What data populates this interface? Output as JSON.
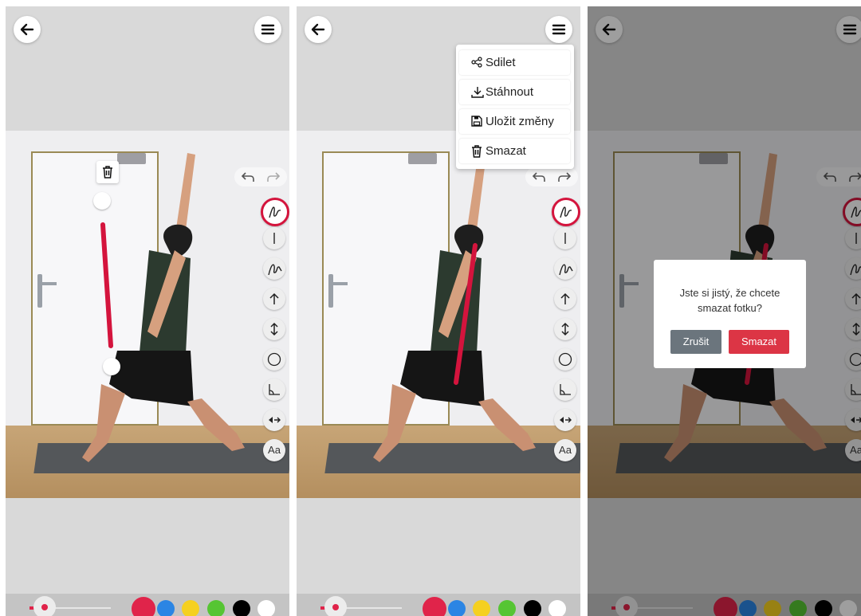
{
  "colors": {
    "accent": "#e0244a",
    "palette": [
      "#e0244a",
      "#2b85e4",
      "#f5d020",
      "#56c533",
      "#000000",
      "#ffffff"
    ]
  },
  "icons": {
    "back": "arrow-left-icon",
    "menu": "hamburger-menu-icon",
    "undo": "undo-icon",
    "redo": "redo-icon",
    "tools": [
      "freehand-curve-icon",
      "straight-line-icon",
      "double-curve-icon",
      "arrow-up-icon",
      "double-arrow-icon",
      "circle-icon",
      "angle-icon",
      "eye-arrow-icon",
      "text-icon"
    ]
  },
  "tools": {
    "text_label": "Aa"
  },
  "menu": {
    "items": [
      {
        "label": "Sdilet",
        "icon": "share-icon"
      },
      {
        "label": "Stáhnout",
        "icon": "download-icon"
      },
      {
        "label": "Uložit změny",
        "icon": "save-icon"
      },
      {
        "label": "Smazat",
        "icon": "trash-icon"
      }
    ]
  },
  "dialog": {
    "message": "Jste si jistý, že chcete smazat fotku?",
    "cancel_label": "Zrušit",
    "delete_label": "Smazat"
  },
  "stroke_width": {
    "value": 0.15
  }
}
